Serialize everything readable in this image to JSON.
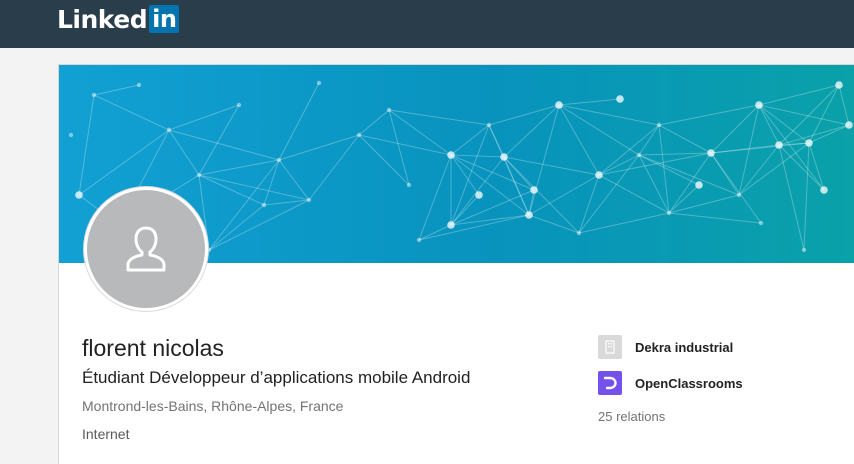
{
  "header": {
    "logo_text": "Linked",
    "logo_box_text": "in",
    "background_color": "#293e4a",
    "brand_color": "#0073b1"
  },
  "profile": {
    "name": "florent nicolas",
    "headline": "Étudiant Développeur d’applications mobile Android",
    "location": "Montrond-les-Bains, Rhône-Alpes, France",
    "industry": "Internet",
    "avatar_icon": "person-placeholder-icon"
  },
  "aside": {
    "positions": [
      {
        "company": "Dekra industrial",
        "icon": "building-placeholder-icon"
      },
      {
        "company": "OpenClassrooms",
        "icon": "openclassrooms-logo-icon",
        "color": "#7451eb"
      }
    ],
    "connections": "25 relations"
  }
}
